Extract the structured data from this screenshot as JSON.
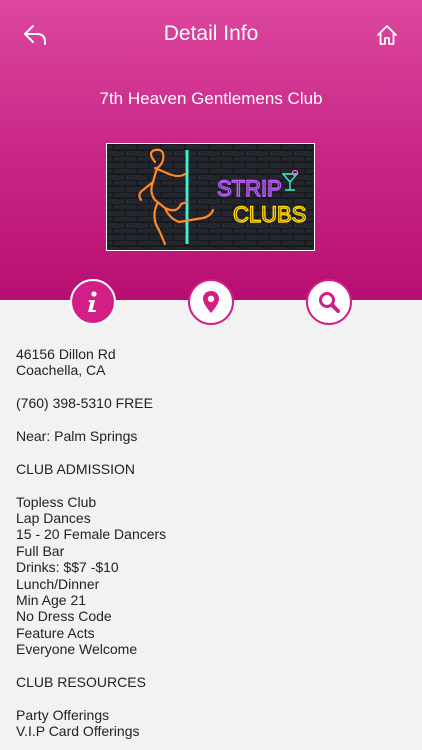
{
  "header": {
    "title": "Detail Info",
    "back_icon": "back-arrow-icon",
    "home_icon": "home-icon"
  },
  "club": {
    "name": "7th Heaven Gentlemens Club",
    "banner": {
      "line1": "STRIP",
      "line2": "CLUBS"
    }
  },
  "actions": [
    {
      "icon": "info-icon",
      "active": true
    },
    {
      "icon": "map-pin-icon",
      "active": false
    },
    {
      "icon": "search-icon",
      "active": false
    }
  ],
  "details": {
    "address_line1": "46156 Dillon Rd",
    "address_line2": "Coachella, CA",
    "phone": "(760) 398-5310 FREE",
    "near": "Near: Palm Springs",
    "admission_heading": "CLUB ADMISSION",
    "admission_items": [
      "Topless Club",
      "Lap Dances",
      "15 - 20 Female Dancers",
      "Full Bar",
      "Drinks: $$7 -$10",
      "Lunch/Dinner",
      "Min Age 21",
      "No Dress Code",
      "Feature Acts",
      "Everyone Welcome"
    ],
    "resources_heading": "CLUB RESOURCES",
    "resources_items": [
      "Party Offerings",
      "V.I.P Card Offerings"
    ]
  },
  "colors": {
    "accent": "#d21f85",
    "header_top": "#dc479f",
    "header_bottom": "#b70f71",
    "background": "#f2f2f2"
  }
}
